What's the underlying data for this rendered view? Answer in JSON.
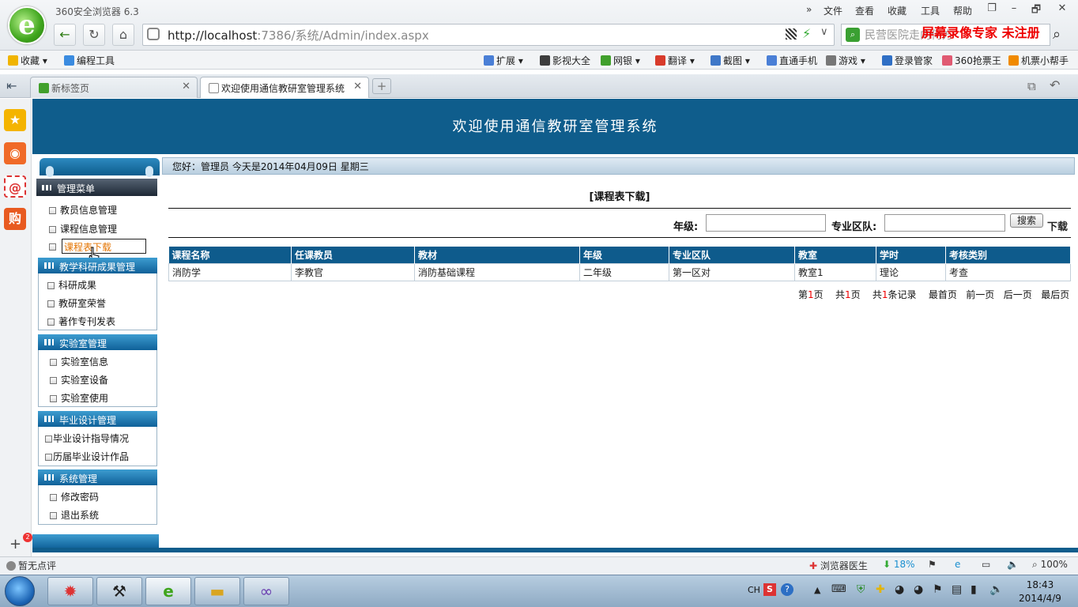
{
  "browser": {
    "app_name": "360安全浏览器 6.3",
    "menu": [
      "文件",
      "查看",
      "收藏",
      "工具",
      "帮助"
    ],
    "window_controls": [
      "❐",
      "–",
      "🗗",
      "✕"
    ],
    "url_host": "http://localhost",
    "url_rest": ":7386/系统/Admin/index.aspx",
    "search_text": "民营医院走向何方",
    "recorder_watermark": "屏幕录像专家  未注册",
    "favorites": [
      {
        "label": "收藏",
        "icon": "star-icon",
        "color": "#f0b400"
      },
      {
        "label": "编程工具",
        "icon": "ie-icon",
        "color": "#3a8be0"
      }
    ],
    "toolbar_items": [
      {
        "label": "扩展",
        "icon": "grid-icon",
        "color": "#4a7fd6"
      },
      {
        "label": "影视大全",
        "icon": "film-icon",
        "color": "#3d3d3d"
      },
      {
        "label": "网银",
        "icon": "shield-icon",
        "color": "#41a02c"
      },
      {
        "label": "翻译",
        "icon": "translate-icon",
        "color": "#d83b2b"
      },
      {
        "label": "截图",
        "icon": "scissor-icon",
        "color": "#3f78c8"
      },
      {
        "label": "直通手机",
        "icon": "phone-icon",
        "color": "#4a7fd6"
      },
      {
        "label": "游戏",
        "icon": "gamepad-icon",
        "color": "#777777"
      },
      {
        "label": "登录管家",
        "icon": "key-icon",
        "color": "#2f6fc5"
      },
      {
        "label": "360抢票王",
        "icon": "ticket-icon",
        "color": "#e05a72"
      },
      {
        "label": "机票小帮手",
        "icon": "plane-icon",
        "color": "#f08a00"
      }
    ],
    "tabs": [
      {
        "label": "新标签页"
      },
      {
        "label": "欢迎使用通信教研室管理系统"
      }
    ]
  },
  "page": {
    "header_title": "欢迎使用通信教研室管理系统",
    "info_bar": "您好：管理员    今天是2014年04月09日    星期三",
    "menu_header": "管理菜单",
    "sections": [
      {
        "title": "",
        "items": [
          "教员信息管理",
          "课程信息管理"
        ]
      },
      {
        "title": "教学科研成果管理",
        "items": [
          "科研成果",
          "教研室荣誉",
          "著作专刊发表"
        ]
      },
      {
        "title": "实验室管理",
        "items": [
          "实验室信息",
          "实验室设备",
          "实验室使用"
        ]
      },
      {
        "title": "毕业设计管理",
        "items": [
          "毕业设计指导情况",
          "历届毕业设计作品"
        ]
      },
      {
        "title": "系统管理",
        "items": [
          "修改密码",
          "退出系统"
        ]
      }
    ],
    "selected_item": "课程表下载",
    "content_title": "[课程表下载]",
    "filter": {
      "grade_label": "年级:",
      "grade_value": "",
      "team_label": "专业区队:",
      "team_value": "",
      "search_button": "搜索",
      "download_link": "下载"
    },
    "table": {
      "headers": [
        "课程名称",
        "任课教员",
        "教材",
        "年级",
        "专业区队",
        "教室",
        "学时",
        "考核类别"
      ],
      "rows": [
        [
          "消防学",
          "李教官",
          "消防基础课程",
          "二年级",
          "第一区对",
          "教室1",
          "理论",
          "考查"
        ]
      ]
    },
    "pager": {
      "page_prefix": "第",
      "page_num": "1",
      "page_suffix": "页",
      "total_prefix": "共",
      "total_pages": "1",
      "total_suffix": "页",
      "rec_prefix": "共",
      "records": "1",
      "rec_suffix": "条记录",
      "first": "最首页",
      "prev": "前一页",
      "next": "后一页",
      "last": "最后页"
    }
  },
  "status": {
    "left": "暂无点评",
    "doctor": "浏览器医生",
    "download_pct": "18%",
    "zoom": "100%"
  },
  "taskbar": {
    "ime": "CH",
    "time": "18:43",
    "date": "2014/4/9"
  },
  "colors": {
    "header_bg": "#0f5d8c",
    "table_header_bg": "#0e5b8c",
    "selected_text": "#e37300",
    "pager_highlight": "#ee0000",
    "watermark": "#ee0000"
  }
}
